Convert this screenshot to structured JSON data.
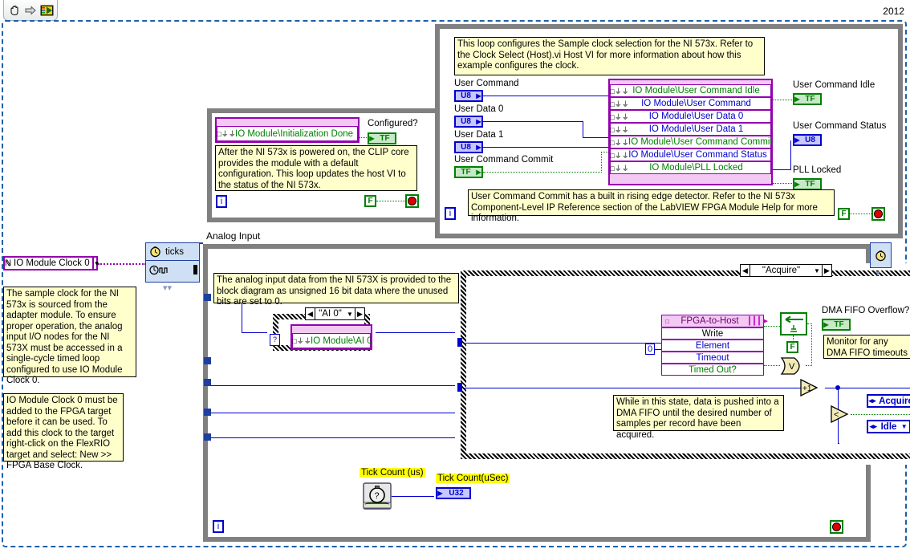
{
  "window": {
    "version_label": "2012",
    "toolbar_icons": [
      "hand-tool-icon",
      "arrow-tool-icon",
      "labview-run-icon"
    ]
  },
  "init_loop": {
    "io_node_label": "IO Module\\Initialization Done",
    "indicator_label": "Configured?",
    "indicator_type": "TF",
    "comment": "After the NI 573x is powered on, the CLIP core provides the module with a default configuration. This loop updates the host VI to the status of the NI 573x.",
    "iteration_terminal": "i",
    "false_constant": "F",
    "stop_button": "stop-led"
  },
  "clock_loop": {
    "top_comment": "This loop configures the Sample clock selection for the NI 573x. Refer to the Clock Select (Host).vi Host VI for more information about how this example configures the clock.",
    "bottom_comment": "User Command Commit has a built in rising edge detector. Refer to the NI 573x Component-Level IP Reference section of the LabVIEW FPGA Module Help for more information.",
    "inputs": [
      {
        "label": "User Command",
        "type": "U8"
      },
      {
        "label": "User Data 0",
        "type": "U8"
      },
      {
        "label": "User Data 1",
        "type": "U8"
      },
      {
        "label": "User Command Commit",
        "type": "TF"
      }
    ],
    "io_node_rows": [
      {
        "name": "IO Module\\User Command Idle",
        "color": "green"
      },
      {
        "name": "IO Module\\User Command",
        "color": "blue"
      },
      {
        "name": "IO Module\\User Data 0",
        "color": "blue"
      },
      {
        "name": "IO Module\\User Data 1",
        "color": "blue"
      },
      {
        "name": "IO Module\\User Command Commit",
        "color": "green"
      },
      {
        "name": "IO Module\\User Command Status",
        "color": "blue"
      },
      {
        "name": "IO Module\\PLL Locked",
        "color": "green"
      }
    ],
    "outputs": [
      {
        "label": "User Command Idle",
        "type": "TF"
      },
      {
        "label": "User Command Status",
        "type": "U8"
      },
      {
        "label": "PLL Locked",
        "type": "TF"
      }
    ],
    "iteration_terminal": "i",
    "false_constant": "F",
    "stop_button": "stop-led"
  },
  "left_panel": {
    "clock_constant": "IO Module Clock 0",
    "comment_1": "The sample clock for the NI 573x is sourced from the adapter module. To ensure proper operation, the analog input I/O nodes for the NI 573X must be accessed in a single-cycle timed loop configured to use IO Module Clock 0.",
    "comment_2": "IO Module Clock 0 must be added to the FPGA target before it can be used. To add this clock to the target right-click on the FlexRIO target and select: New >> FPGA Base Clock."
  },
  "timed_loop": {
    "title": "Analog Input",
    "ticks_label": "ticks",
    "ai_comment": "The analog input data from the NI 573X is provided to the block diagram as unsigned 16 bit data where the unused bits are set to 0.",
    "ai_case_label": "\"AI 0\"",
    "ai_io_node": "IO Module\\AI 0",
    "state_case_label": "\"Acquire\"",
    "fifo": {
      "header": "FPGA-to-Host",
      "rows": [
        "Write",
        "Element",
        "Timeout",
        "Timed Out?"
      ],
      "timeout_constant": "0"
    },
    "overflow": {
      "label": "DMA FIFO Overflow?",
      "type": "TF",
      "comment": "Monitor for any DMA FIFO timeouts",
      "false_constant": "F"
    },
    "state_comment": "While in this state, data is pushed into a DMA FIFO until the desired number of samples per record have been acquired.",
    "enums": [
      {
        "value": "Acquire"
      },
      {
        "value": "Idle"
      }
    ],
    "operators": [
      {
        "name": "increment",
        "glyph": "+1"
      },
      {
        "name": "less-than",
        "glyph": "<"
      },
      {
        "name": "or",
        "glyph": "V"
      },
      {
        "name": "select",
        "glyph": "?"
      }
    ],
    "tick_count": {
      "vi_label": "Tick Count (us)",
      "indicator_label": "Tick Count(uSec)",
      "indicator_type": "U32"
    },
    "iteration_terminal": "i",
    "stop_button": "stop-led"
  },
  "colors": {
    "io_node_border": "#9400b0",
    "io_node_fill": "#f3c9f3",
    "comment_bg": "#ffffcc",
    "wire_blue": "#0000cc",
    "wire_green": "#008000",
    "loop_gray": "#808080",
    "timed_loop_blue": "#1f3f9f"
  }
}
